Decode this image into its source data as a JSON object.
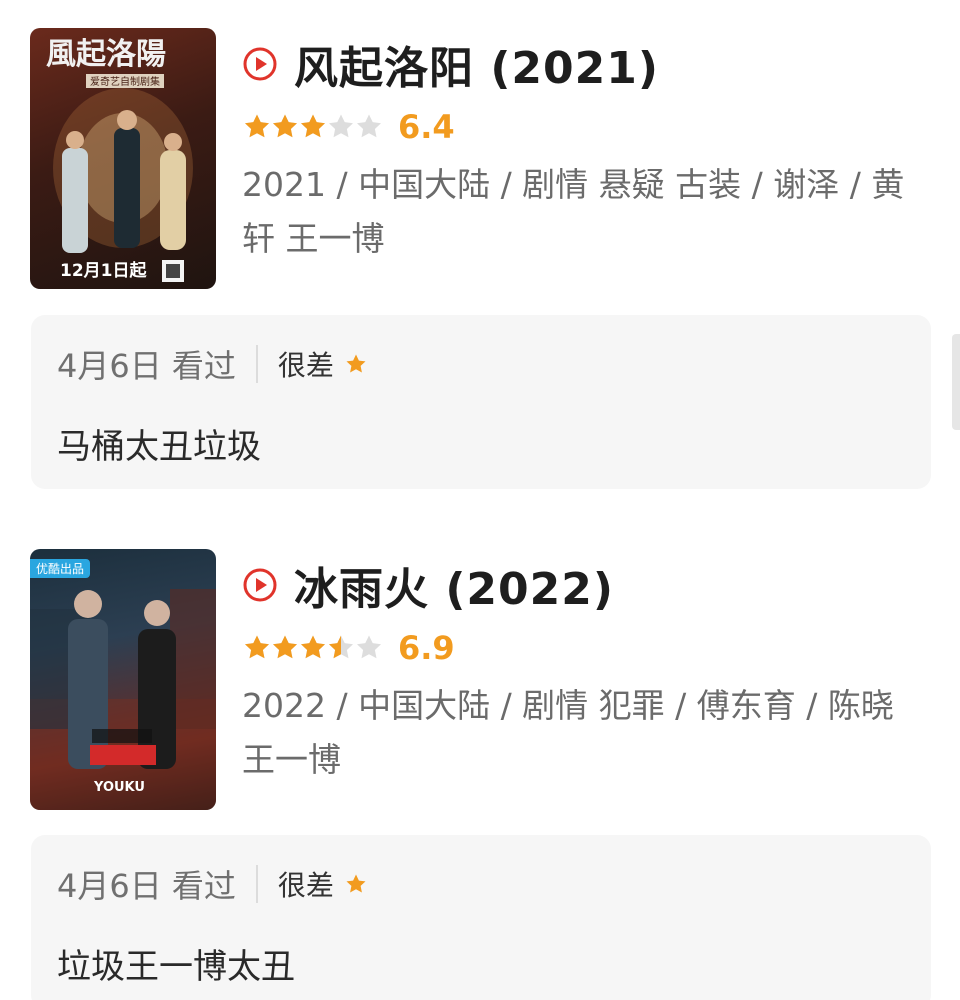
{
  "items": [
    {
      "title": "风起洛阳 (2021)",
      "rating_stars": 3,
      "score": "6.4",
      "meta": "2021 / 中国大陆 / 剧情 悬疑 古装 / 谢泽 / 黄轩 王一博",
      "poster": {
        "calligraphy": "風起洛陽",
        "subtitle": "爱奇艺自制剧集",
        "release": "12月1日起"
      },
      "review": {
        "date_watched": "4月6日 看过",
        "rating_label": "很差",
        "text": "马桶太丑垃圾"
      }
    },
    {
      "title": "冰雨火 (2022)",
      "rating_stars": 3.5,
      "score": "6.9",
      "meta": "2022 / 中国大陆 / 剧情 犯罪 / 傅东育 / 陈晓 王一博",
      "poster": {
        "tag": "优酷出品",
        "logo": "YOUKU"
      },
      "review": {
        "date_watched": "4月6日 看过",
        "rating_label": "很差",
        "text": "垃圾王一博太丑"
      }
    }
  ],
  "colors": {
    "play_icon": "#e0342b",
    "star_filled": "#f29b1f",
    "star_empty": "#dddddd",
    "review_bg": "#f6f6f6"
  },
  "icons": {
    "play": "play-circle-icon",
    "star": "star-icon"
  }
}
